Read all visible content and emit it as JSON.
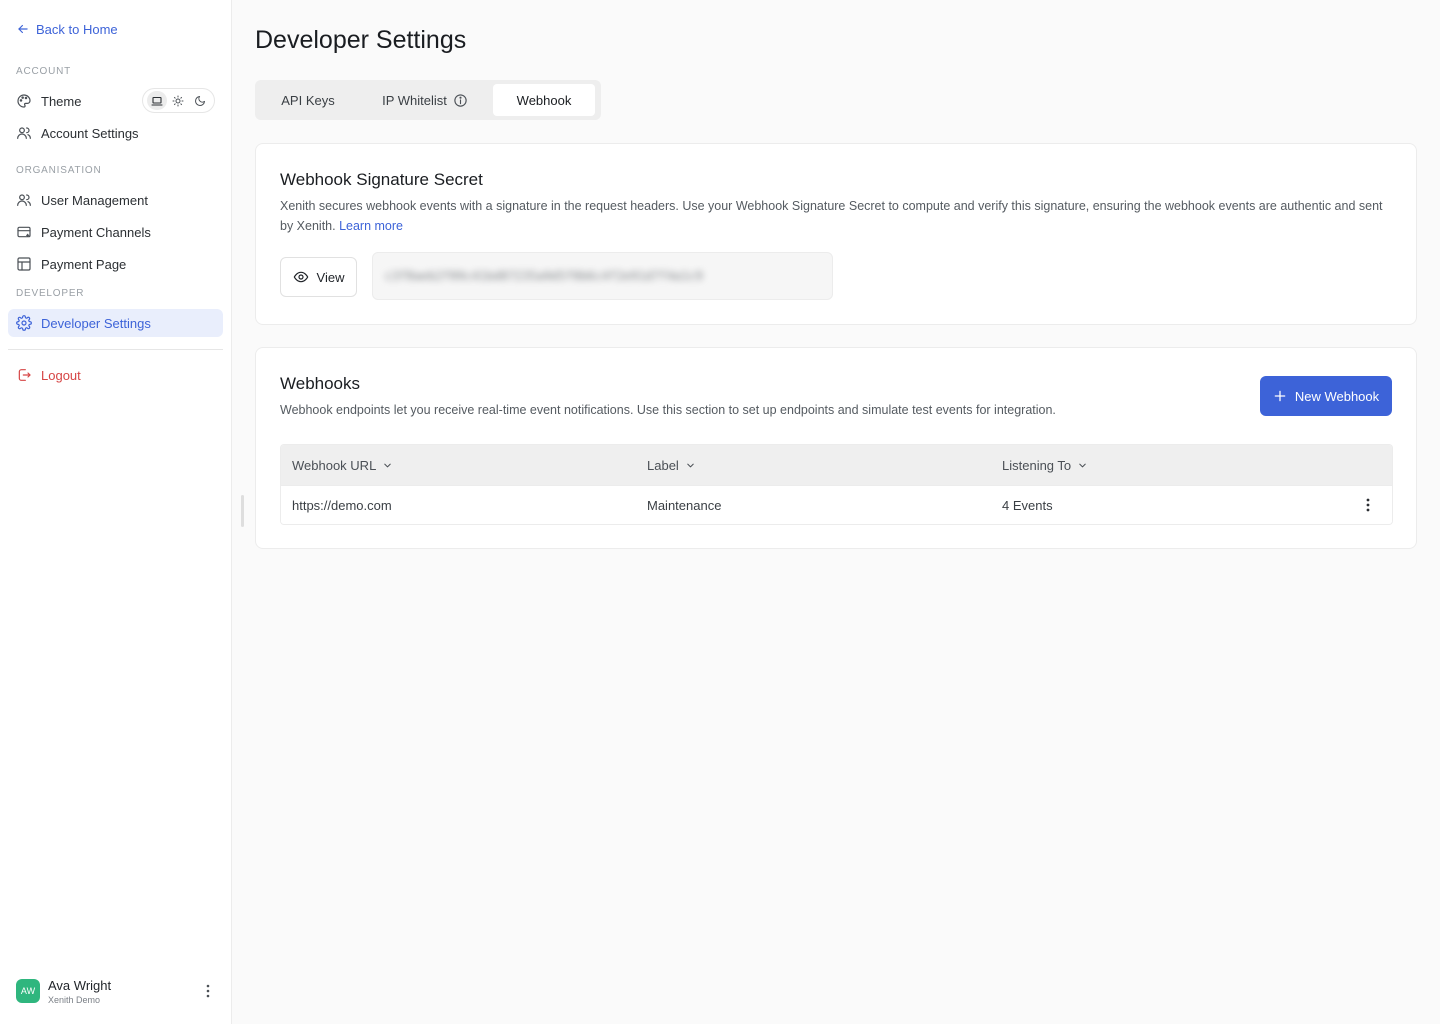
{
  "sidebar": {
    "back_label": "Back to Home",
    "sections": {
      "account": "ACCOUNT",
      "organisation": "ORGANISATION",
      "developer": "DEVELOPER"
    },
    "items": {
      "theme": "Theme",
      "account_settings": "Account Settings",
      "user_management": "User Management",
      "payment_channels": "Payment Channels",
      "payment_page": "Payment Page",
      "developer_settings": "Developer Settings",
      "logout": "Logout"
    },
    "theme_options": [
      "laptop-icon",
      "sun-icon",
      "moon-icon"
    ],
    "theme_selected": "laptop-icon",
    "user": {
      "initials": "AW",
      "name": "Ava Wright",
      "org": "Xenith Demo"
    }
  },
  "page": {
    "title": "Developer Settings",
    "tabs": [
      "API Keys",
      "IP Whitelist",
      "Webhook"
    ],
    "active_tab": "Webhook"
  },
  "signature": {
    "title": "Webhook Signature Secret",
    "description": "Xenith secures webhook events with a signature in the request headers. Use your Webhook Signature Secret to compute and verify this signature, ensuring the webhook events are authentic and sent by Xenith.",
    "learn_more": "Learn more",
    "view_label": "View",
    "secret_masked": "c3f8aeb2f09c41bd87235a9d5f0b6c4f2e91d7f4a1c9"
  },
  "webhooks": {
    "title": "Webhooks",
    "description": "Webhook endpoints let you receive real-time event notifications. Use this section to set up endpoints and simulate test events for integration.",
    "new_button": "New Webhook",
    "columns": [
      "Webhook URL",
      "Label",
      "Listening To"
    ],
    "rows": [
      {
        "url": "https://demo.com",
        "label": "Maintenance",
        "listening": "4 Events"
      }
    ]
  },
  "colors": {
    "accent": "#3d63d8",
    "danger": "#d64545",
    "avatar": "#2fb67e"
  }
}
